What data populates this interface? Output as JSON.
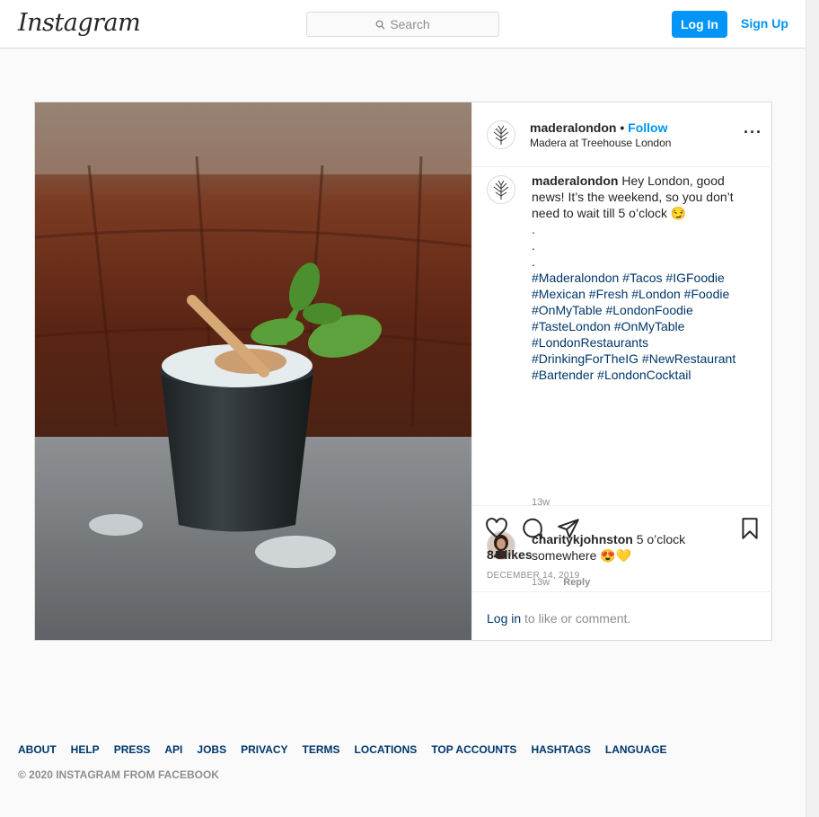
{
  "nav": {
    "logo_text": "Instagram",
    "search_placeholder": "Search",
    "login_label": "Log In",
    "signup_label": "Sign Up"
  },
  "post": {
    "username": "maderalondon",
    "separator": "•",
    "follow_label": "Follow",
    "location": "Madera at Treehouse London",
    "more_icon": "more-options-icon",
    "caption": {
      "username": "maderalondon",
      "text": "Hey London, good news! It’s the weekend, so you don’t need to wait till 5 o’clock 😏",
      "dots": [
        ".",
        ".",
        "."
      ],
      "hashtag_lines": [
        "#Maderalondon #Tacos #IGFoodie",
        "#Mexican #Fresh #London #Foodie",
        "#OnMyTable #LondonFoodie",
        "#TasteLondon #OnMyTable",
        "#LondonRestaurants",
        "#DrinkingForTheIG #NewRestaurant",
        "#Bartender #LondonCocktail"
      ],
      "time": "13w"
    },
    "comments": [
      {
        "username": "charitykjohnston",
        "text": "5 o’clock somewhere 😍💛",
        "time": "13w",
        "reply_label": "Reply"
      }
    ],
    "likes": "84 likes",
    "date": "DECEMBER 14, 2019",
    "login_prompt": {
      "link": "Log in",
      "rest": " to like or comment."
    }
  },
  "footer": {
    "links": [
      "ABOUT",
      "HELP",
      "PRESS",
      "API",
      "JOBS",
      "PRIVACY",
      "TERMS",
      "LOCATIONS",
      "TOP ACCOUNTS",
      "HASHTAGS",
      "LANGUAGE"
    ],
    "copyright": "© 2020 INSTAGRAM FROM FACEBOOK"
  },
  "colors": {
    "accent": "#0095f6",
    "link": "#00376b",
    "muted": "#8e8e8e"
  }
}
